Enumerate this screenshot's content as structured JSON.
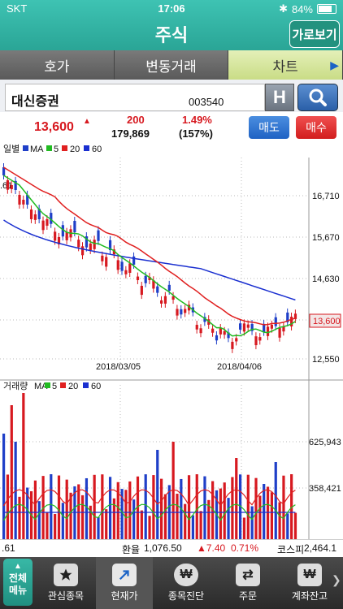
{
  "status": {
    "carrier": "SKT",
    "time": "17:06",
    "battery": "84%"
  },
  "header": {
    "title": "주식",
    "landscape_label": "가로보기"
  },
  "tabs": [
    {
      "label": "호가"
    },
    {
      "label": "변동거래"
    },
    {
      "label": "차트"
    }
  ],
  "stock": {
    "name": "대신증권",
    "code": "003540",
    "h_label": "H"
  },
  "quote": {
    "price": "13,600",
    "change": "200",
    "volume": "179,869",
    "change_pct": "1.49%",
    "volume_pct": "(157%)",
    "sell_label": "매도",
    "buy_label": "매수"
  },
  "price_chart": {
    "legend": {
      "period": "일별",
      "ma": "MA",
      "ma5": "5",
      "ma20": "20",
      "ma60": "60"
    },
    "left_value": ".61",
    "y_ticks": [
      "16,710",
      "15,670",
      "14,630",
      "13,600",
      "12,550"
    ],
    "x_ticks": [
      "2018/03/05",
      "2018/04/06"
    ],
    "current_tag": "13,600"
  },
  "volume_chart": {
    "legend": {
      "label": "거래량",
      "ma": "MA",
      "ma5": "5",
      "ma20": "20",
      "ma60": "60"
    },
    "y_ticks": [
      "625,943",
      "358,421"
    ]
  },
  "infobar": {
    "left": ".61",
    "fx_label": "환율",
    "fx_value": "1,076.50",
    "fx_change": "▲7.40",
    "fx_pct": "0.71%",
    "kospi_label": "코스피",
    "kospi_value": "2,464.1"
  },
  "nav": {
    "all_menu": "전체 메뉴",
    "items": [
      {
        "label": "관심종목",
        "icon": "star-icon"
      },
      {
        "label": "현재가",
        "icon": "arrow-icon"
      },
      {
        "label": "종목진단",
        "icon": "won-bag-icon"
      },
      {
        "label": "주문",
        "icon": "order-icon"
      },
      {
        "label": "계좌잔고",
        "icon": "won-icon"
      }
    ]
  },
  "colors": {
    "up": "#d71920",
    "down": "#1f3fc8",
    "ma5": "#22bb22",
    "ma20": "#e02020",
    "ma60": "#1a2fd0"
  },
  "chart_data": {
    "type": "candlestick",
    "price_ylim": [
      12550,
      16710
    ],
    "candles_note": "",
    "series": [
      {
        "name": "MA 5"
      },
      {
        "name": "MA 20"
      },
      {
        "name": "MA 60"
      }
    ]
  }
}
